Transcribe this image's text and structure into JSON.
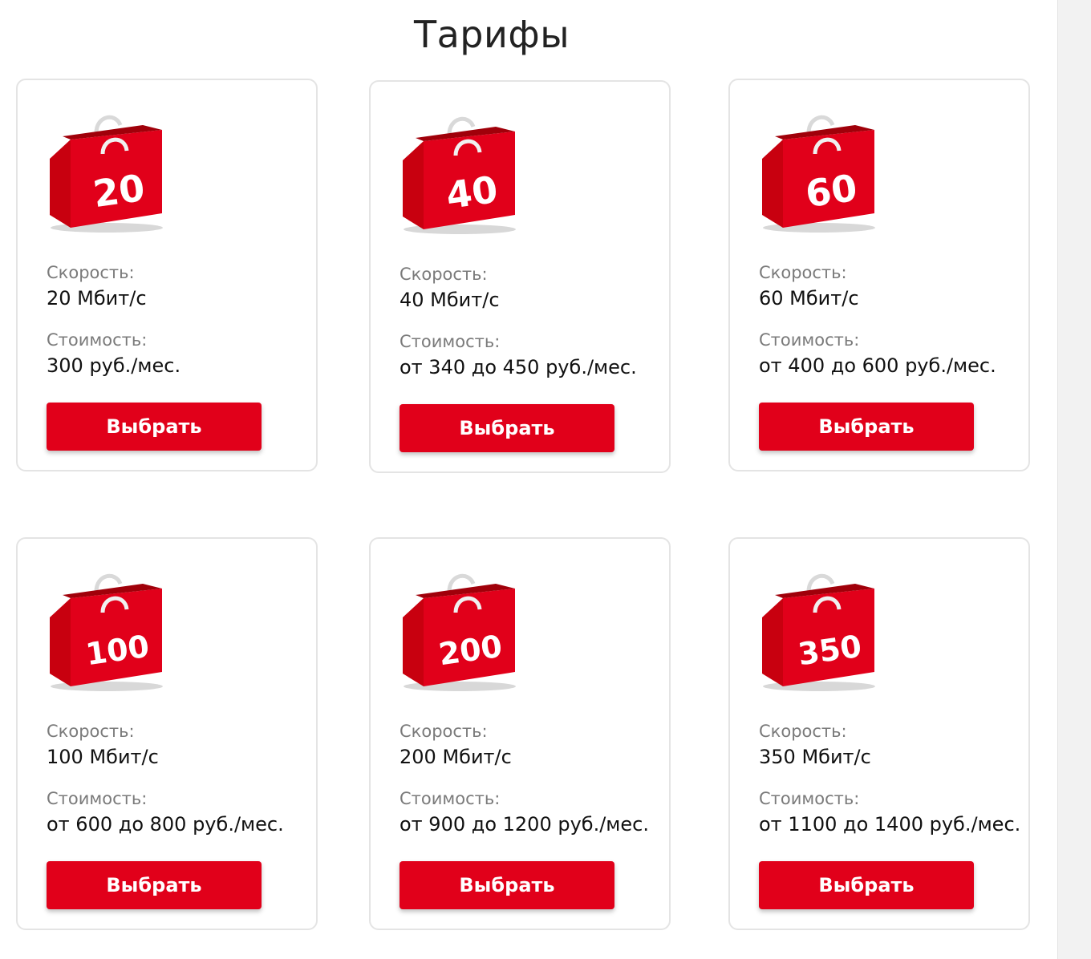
{
  "page": {
    "title": "Тарифы"
  },
  "labels": {
    "speed": "Скорость:",
    "price": "Стоимость:",
    "button": "Выбрать"
  },
  "colors": {
    "accent": "#e1001a",
    "card_border": "#e4e4e4"
  },
  "tariffs": [
    {
      "bag_number": "20",
      "speed": "20 Мбит/с",
      "price": "300 руб./мес."
    },
    {
      "bag_number": "40",
      "speed": "40 Мбит/с",
      "price": "от 340 до 450 руб./мес."
    },
    {
      "bag_number": "60",
      "speed": "60 Мбит/с",
      "price": "от 400 до 600 руб./мес."
    },
    {
      "bag_number": "100",
      "speed": "100 Мбит/с",
      "price": "от 600 до 800 руб./мес."
    },
    {
      "bag_number": "200",
      "speed": "200 Мбит/с",
      "price": "от 900 до 1200 руб./мес."
    },
    {
      "bag_number": "350",
      "speed": "350 Мбит/с",
      "price": "от 1100 до 1400 руб./мес."
    }
  ]
}
